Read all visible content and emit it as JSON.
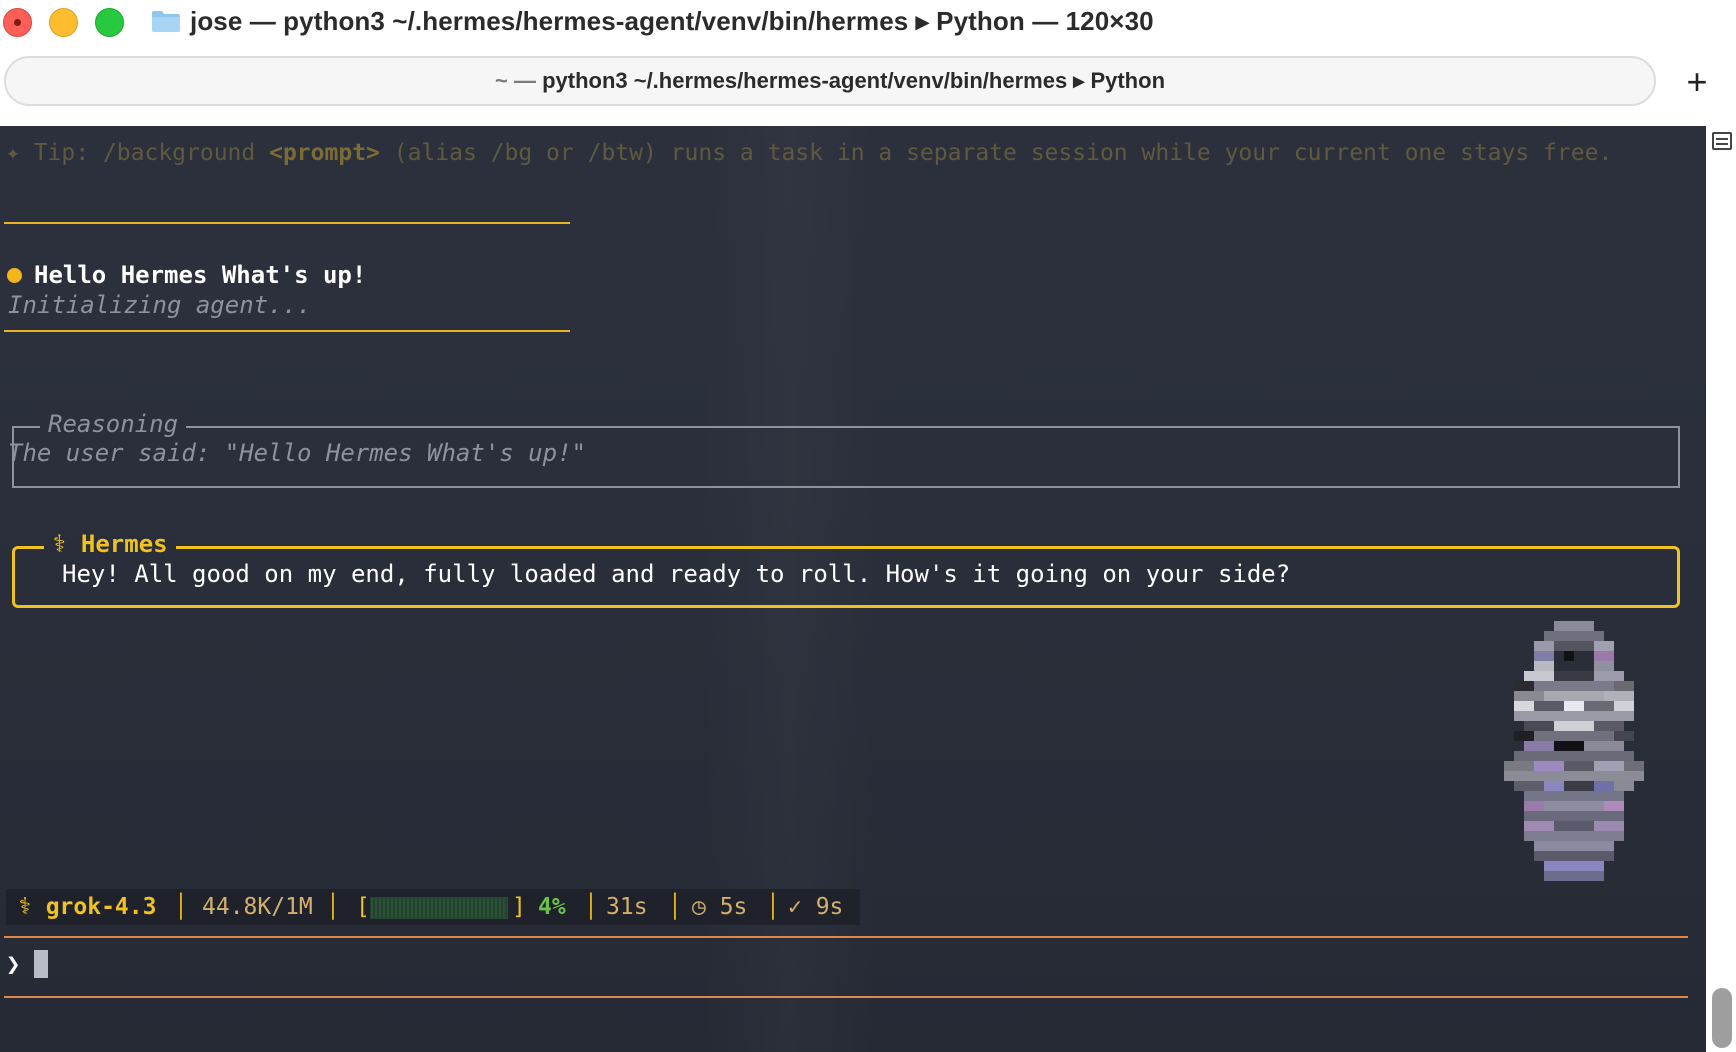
{
  "window": {
    "title": "jose — python3 ~/.hermes/hermes-agent/venv/bin/hermes ▸ Python — 120×30"
  },
  "tab": {
    "prefix": "~ — ",
    "title": "python3 ~/.hermes/hermes-agent/venv/bin/hermes ▸ Python",
    "new_tab_label": "+"
  },
  "terminal": {
    "tip_prefix": "✦ Tip: /background ",
    "tip_arg": "<prompt>",
    "tip_suffix": " (alias /bg or /btw) runs a task in a separate session while your current one stays free.",
    "user_message": "Hello Hermes What's up!",
    "status_init": "Initializing agent...",
    "reasoning_title": "Reasoning",
    "reasoning_text": "The user said: \"Hello Hermes What's up!\"",
    "assistant_title": "⚕ Hermes",
    "assistant_text": "Hey! All good on my end, fully loaded and ready to roll. How's it going on your side?",
    "prompt_symbol": "❯"
  },
  "status_bar": {
    "model": "⚕ grok-4.3",
    "tokens": "44.8K/1M",
    "bar_open": "[",
    "bar_close": "]",
    "context_percent": 4,
    "context_label": "4%",
    "elapsed": "31s",
    "timer": "◷ 5s",
    "done": "✓ 9s",
    "separator": "│"
  },
  "colors": {
    "accent": "#f0c11f",
    "terminal_bg": "#2a2e3b",
    "progress": "#6cc24a",
    "input_rule": "#e0884c"
  }
}
